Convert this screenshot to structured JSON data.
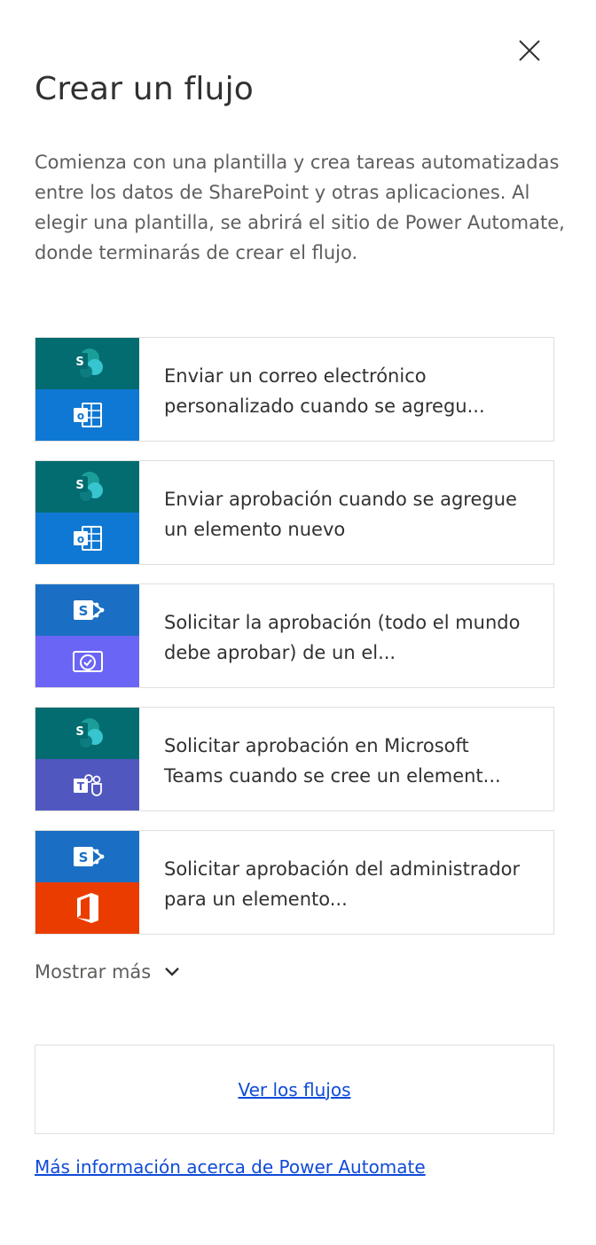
{
  "panel": {
    "title": "Crear un flujo",
    "description": "Comienza con una plantilla y crea tareas automatizadas entre los datos de SharePoint y otras aplicaciones. Al elegir una plantilla, se abrirá el sitio de Power Automate, donde terminarás de crear el flujo."
  },
  "templates": [
    {
      "label": "Enviar un correo electrónico personalizado cuando se agregu...",
      "top_icon": "sharepoint-icon",
      "bottom_icon": "outlook-icon"
    },
    {
      "label": "Enviar aprobación cuando se agregue un elemento nuevo",
      "top_icon": "sharepoint-icon",
      "bottom_icon": "outlook-icon"
    },
    {
      "label": "Solicitar la aprobación (todo el mundo debe aprobar) de un el...",
      "top_icon": "sharepoint-icon",
      "bottom_icon": "approvals-icon"
    },
    {
      "label": "Solicitar aprobación en Microsoft Teams cuando se cree un element...",
      "top_icon": "sharepoint-icon",
      "bottom_icon": "teams-icon"
    },
    {
      "label": "Solicitar aprobación del administrador para un elemento...",
      "top_icon": "sharepoint-icon",
      "bottom_icon": "office-icon"
    }
  ],
  "show_more": {
    "label": "Mostrar más"
  },
  "links": {
    "view_flows": "Ver los flujos",
    "more_info": "Más información acerca de Power Automate"
  },
  "colors": {
    "sharepoint_teal": "#036c70",
    "sharepoint_blue": "#1a6fc4",
    "outlook_blue": "#0f78d4",
    "approvals_purple": "#6b65f5",
    "teams_purple": "#5058c0",
    "office_orange": "#eb3c00",
    "link": "#0f4bd8"
  }
}
